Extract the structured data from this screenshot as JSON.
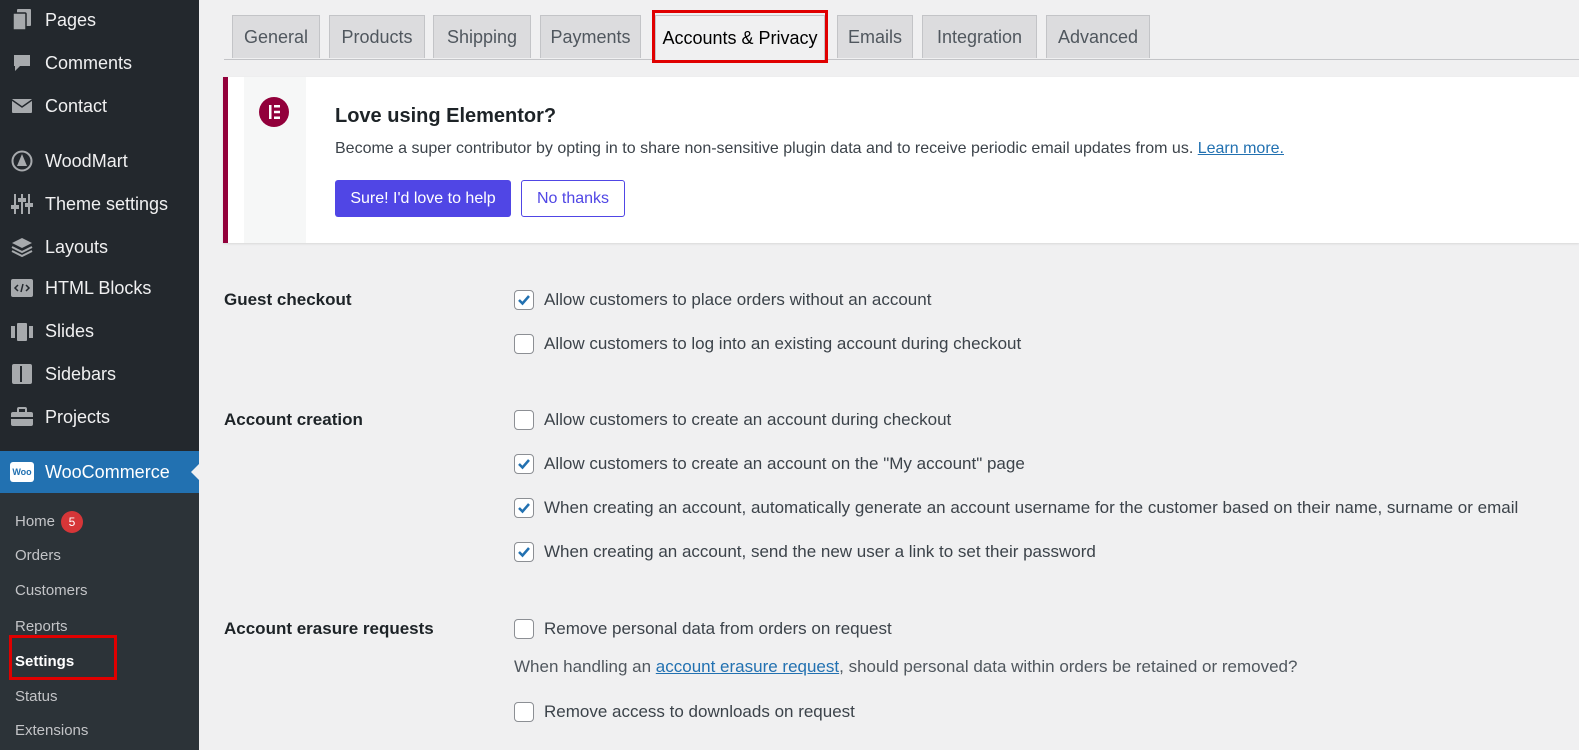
{
  "sidebar": {
    "menu": [
      {
        "label": "Pages",
        "icon": "pages-icon"
      },
      {
        "label": "Comments",
        "icon": "comments-icon"
      },
      {
        "label": "Contact",
        "icon": "envelope-icon"
      },
      {
        "label": "WoodMart",
        "icon": "woodmart-icon"
      },
      {
        "label": "Theme settings",
        "icon": "sliders-icon"
      },
      {
        "label": "Layouts",
        "icon": "layers-icon"
      },
      {
        "label": "HTML Blocks",
        "icon": "code-block-icon"
      },
      {
        "label": "Slides",
        "icon": "slides-icon"
      },
      {
        "label": "Sidebars",
        "icon": "sidebar-icon"
      },
      {
        "label": "Projects",
        "icon": "briefcase-icon"
      }
    ],
    "woocommerce": {
      "label": "WooCommerce",
      "icon_text": "Woo"
    },
    "submenu": [
      {
        "label": "Home",
        "badge": "5"
      },
      {
        "label": "Orders"
      },
      {
        "label": "Customers"
      },
      {
        "label": "Reports"
      },
      {
        "label": "Settings"
      },
      {
        "label": "Status"
      },
      {
        "label": "Extensions"
      }
    ]
  },
  "tabs": [
    "General",
    "Products",
    "Shipping",
    "Payments",
    "Accounts & Privacy",
    "Emails",
    "Integration",
    "Advanced"
  ],
  "active_tab": "Accounts & Privacy",
  "notice": {
    "title": "Love using Elementor?",
    "text": "Become a super contributor by opting in to share non-sensitive plugin data and to receive periodic email updates from us.",
    "link": "Learn more.",
    "primary_button": "Sure! I'd love to help",
    "secondary_button": "No thanks"
  },
  "settings": {
    "guest_checkout": {
      "label": "Guest checkout",
      "options": [
        {
          "text": "Allow customers to place orders without an account",
          "checked": true
        },
        {
          "text": "Allow customers to log into an existing account during checkout",
          "checked": false
        }
      ]
    },
    "account_creation": {
      "label": "Account creation",
      "options": [
        {
          "text": "Allow customers to create an account during checkout",
          "checked": false
        },
        {
          "text": "Allow customers to create an account on the \"My account\" page",
          "checked": true
        },
        {
          "text": "When creating an account, automatically generate an account username for the customer based on their name, surname or email",
          "checked": true
        },
        {
          "text": "When creating an account, send the new user a link to set their password",
          "checked": true
        }
      ]
    },
    "account_erasure": {
      "label": "Account erasure requests",
      "options": [
        {
          "text": "Remove personal data from orders on request",
          "checked": false
        },
        {
          "text": "Remove access to downloads on request",
          "checked": false
        }
      ],
      "desc_prefix": "When handling an ",
      "desc_link": "account erasure request",
      "desc_suffix": ", should personal data within orders be retained or removed?"
    }
  },
  "colors": {
    "accent": "#2271b1",
    "sidebar": "#23282d",
    "elementor": "#92003b",
    "highlight": "#e00000",
    "button": "#5046e5"
  }
}
